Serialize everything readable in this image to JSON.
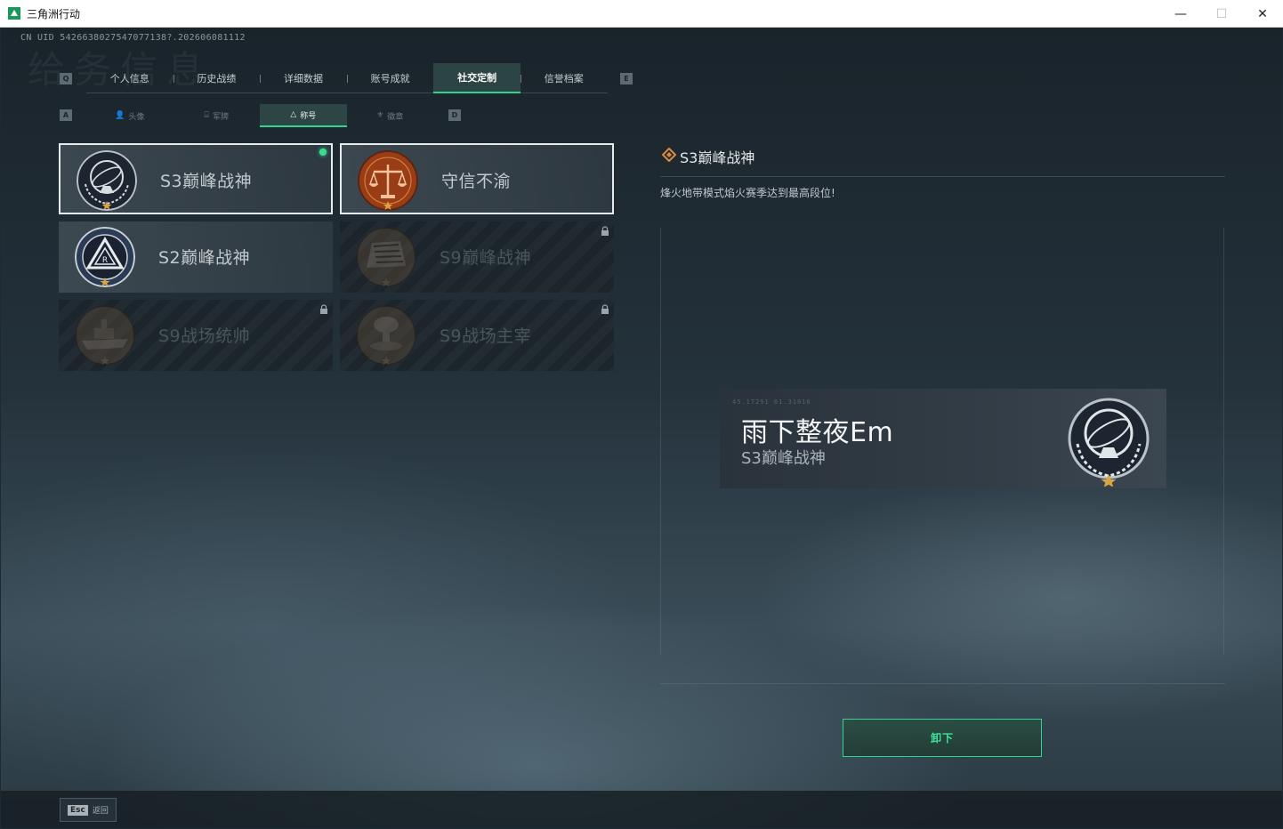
{
  "window": {
    "title": "三角洲行动",
    "controls": {
      "minimize": "—",
      "maximize": "☐",
      "close": "✕"
    }
  },
  "uid": "CN UID 5426638027547077138?.202606081112",
  "ghost_title": "给务信息",
  "main_tabs": {
    "left_key": "Q",
    "right_key": "E",
    "items": [
      {
        "label": "个人信息",
        "active": false
      },
      {
        "label": "历史战绩",
        "active": false
      },
      {
        "label": "详细数据",
        "active": false
      },
      {
        "label": "账号成就",
        "active": false
      },
      {
        "label": "社交定制",
        "active": true
      },
      {
        "label": "信誉档案",
        "active": false
      }
    ]
  },
  "sub_tabs": {
    "left_key": "A",
    "right_key": "D",
    "items": [
      {
        "label": "头像",
        "icon": "person-icon",
        "glyph": "👤",
        "active": false
      },
      {
        "label": "军牌",
        "icon": "dogtag-icon",
        "glyph": "⌸",
        "active": false
      },
      {
        "label": "称号",
        "icon": "triangle-icon",
        "glyph": "△",
        "active": true
      },
      {
        "label": "徽章",
        "icon": "badge-icon",
        "glyph": "⚜",
        "active": false
      }
    ]
  },
  "titles": [
    {
      "name": "S3巅峰战神",
      "locked": false,
      "selected": true,
      "equipped": true,
      "emblem": "armillary-emblem"
    },
    {
      "name": "守信不渝",
      "locked": false,
      "selected": true,
      "equipped": false,
      "emblem": "scales-emblem"
    },
    {
      "name": "S2巅峰战神",
      "locked": false,
      "selected": false,
      "equipped": false,
      "emblem": "triangle-emblem"
    },
    {
      "name": "S9巅峰战神",
      "locked": true,
      "selected": false,
      "equipped": false,
      "emblem": "fortress-emblem"
    },
    {
      "name": "S9战场统帅",
      "locked": true,
      "selected": false,
      "equipped": false,
      "emblem": "warship-emblem"
    },
    {
      "name": "S9战场主宰",
      "locked": true,
      "selected": false,
      "equipped": false,
      "emblem": "mushroom-cloud-emblem"
    }
  ],
  "detail": {
    "title": "S3巅峰战神",
    "description": "烽火地带模式焰火赛季达到最高段位!"
  },
  "nameplate": {
    "player_name": "雨下整夜Em",
    "title": "S3巅峰战神",
    "coords": "45.17291  61.31016"
  },
  "action_button": "卸下",
  "footer": {
    "esc_key": "Esc",
    "esc_label": "返回"
  },
  "colors": {
    "accent": "#2fd58e",
    "gold_star": "#d9a441",
    "bronze_emblem": "#9a3d17"
  }
}
